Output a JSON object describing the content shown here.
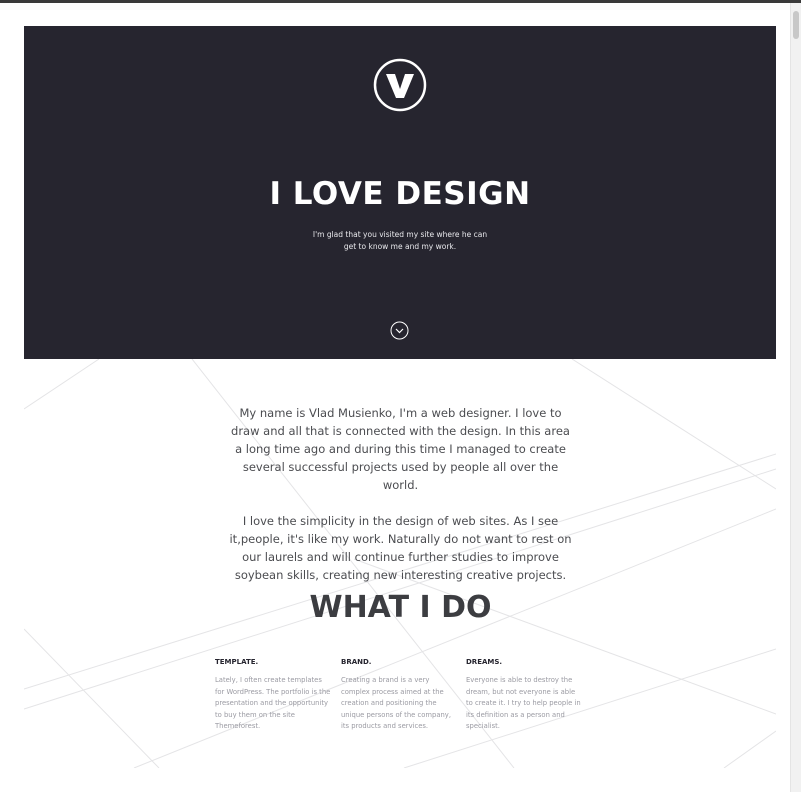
{
  "hero": {
    "title": "I LOVE DESIGN",
    "subtitle": "I'm glad that you visited my site where he can get to know me and my work.",
    "logo_icon": "v-logo-icon",
    "scroll_icon": "chevron-down-circle-icon",
    "background": "#26252f"
  },
  "about": {
    "paragraphs": [
      "My name is Vlad Musienko, I'm a web designer. I love to draw and all that is connected with the design. In this area a long time ago and during this time I managed to create several successful projects used by people all over the world.",
      "I love the simplicity in the design of web sites. As I see it,people, it's like my work. Naturally do not want to rest on our laurels and will continue further studies to improve soybean skills, creating new interesting creative projects."
    ]
  },
  "services": {
    "title": "WHAT I DO",
    "items": [
      {
        "title": "TEMPLATE.",
        "text": "Lately, I often create templates for WordPress. The portfolio is the presentation and the opportunity to buy them on the site Themeforest."
      },
      {
        "title": "BRAND.",
        "text": "Creating a brand is a very complex process aimed at the creation and positioning the unique persons of the company, its products and services."
      },
      {
        "title": "DREAMS.",
        "text": "Everyone is able to destroy the dream, but not everyone is able to create it. I try to help people in its definition as a person and specialist."
      }
    ]
  }
}
